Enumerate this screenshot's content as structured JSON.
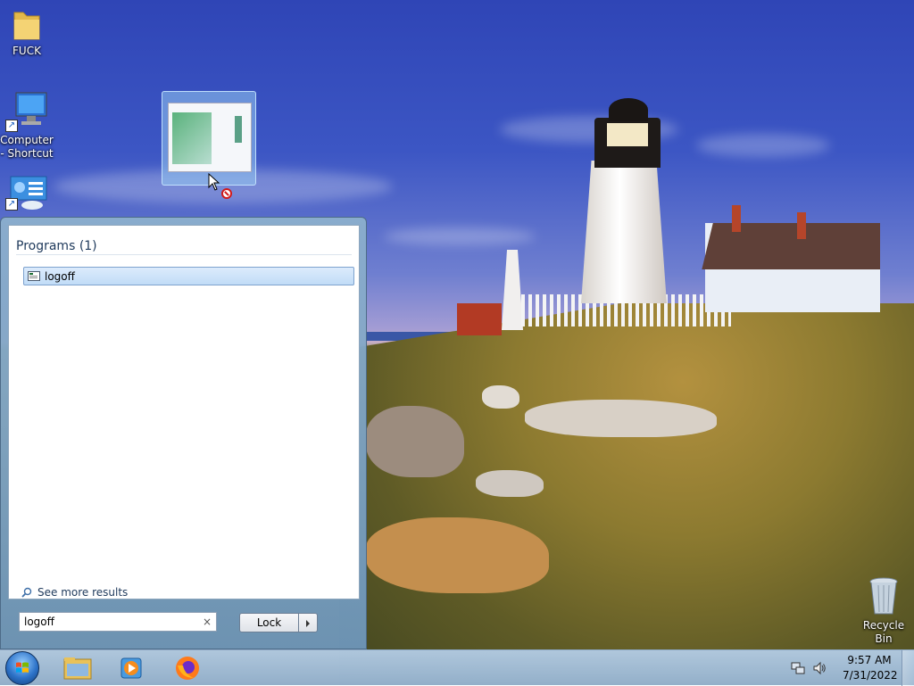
{
  "desktop": {
    "icons": [
      {
        "label": "FUCK",
        "icon": "folder-icon"
      },
      {
        "label": "Computer - Shortcut",
        "icon": "computer-icon"
      },
      {
        "label": "",
        "icon": "control-panel-icon"
      },
      {
        "label": "Recycle Bin",
        "icon": "recycle-bin-icon"
      }
    ]
  },
  "start_menu": {
    "programs_header": "Programs (1)",
    "results": [
      {
        "label": "logoff",
        "icon": "program-icon"
      }
    ],
    "see_more_label": "See more results",
    "search": {
      "value": "logoff",
      "clear_glyph": "×"
    },
    "power_button_label": "Lock"
  },
  "taskbar": {
    "pinned": [
      "file-explorer-icon",
      "media-player-icon",
      "firefox-icon"
    ],
    "tray_icons": [
      "network-icon",
      "volume-icon"
    ],
    "clock": {
      "time": "9:57 AM",
      "date": "7/31/2022"
    }
  },
  "colors": {
    "selection_fill": "#c1dcf7",
    "selection_border": "#7da2ce",
    "header_text": "#1e395b"
  }
}
